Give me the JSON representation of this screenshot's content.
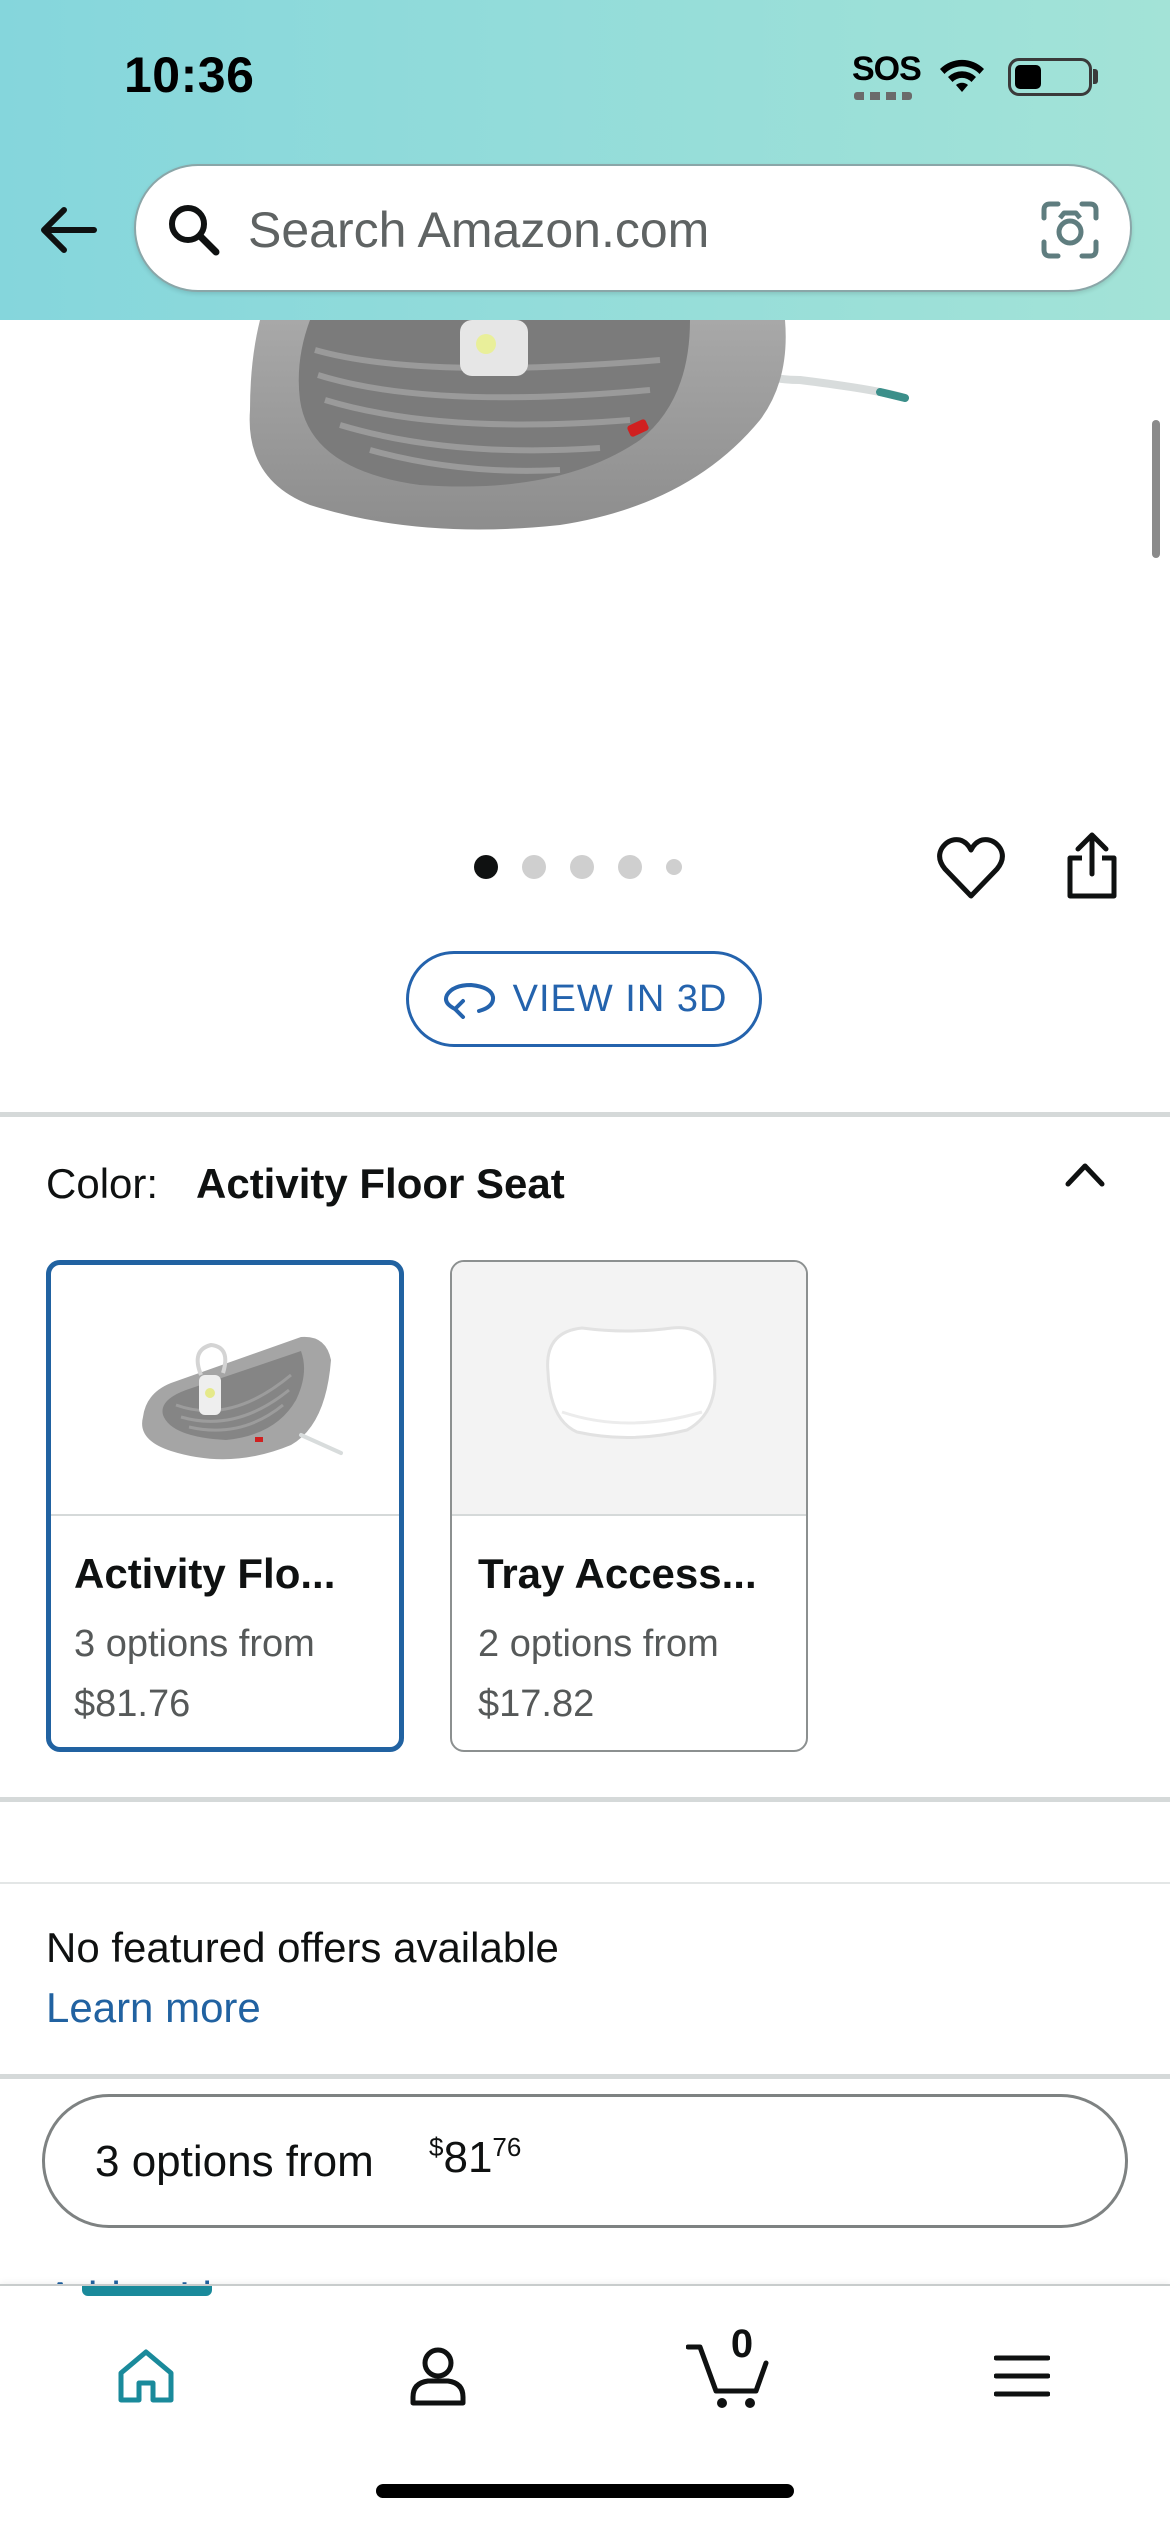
{
  "status_bar": {
    "time": "10:36",
    "sos": "SOS",
    "icons": [
      "wifi-icon",
      "battery-icon"
    ]
  },
  "header": {
    "back_icon": "arrow-left-icon",
    "search": {
      "placeholder": "Search Amazon.com",
      "value": "",
      "icon": "search-icon",
      "camera_icon": "camera-icon"
    }
  },
  "gallery": {
    "image_count": 5,
    "active_index": 0,
    "wishlist_icon": "heart-icon",
    "share_icon": "share-icon",
    "view_3d_label": "VIEW IN 3D"
  },
  "color_selector": {
    "label": "Color:",
    "selected": "Activity Floor Seat",
    "options": [
      {
        "name": "Activity Flo...",
        "subtitle": "3 options from",
        "price": "$81.76",
        "selected": true
      },
      {
        "name": "Tray Access...",
        "subtitle": "2 options from",
        "price": "$17.82",
        "selected": false
      }
    ]
  },
  "offers": {
    "message": "No featured offers available",
    "learn_more": "Learn more",
    "options_button": {
      "text": "3 options from",
      "currency": "$",
      "whole": "81",
      "fraction": "76"
    },
    "add_to_list": "Add to List"
  },
  "bottom_nav": {
    "items": [
      "home-icon",
      "account-icon",
      "cart-icon",
      "menu-icon"
    ],
    "active": "home-icon",
    "cart_count": "0"
  },
  "colors": {
    "header_gradient_start": "#85d6dc",
    "header_gradient_end": "#a3e3d7",
    "link_blue": "#2162a1",
    "selected_border": "#2162a1",
    "nav_accent": "#1a8a9b"
  }
}
